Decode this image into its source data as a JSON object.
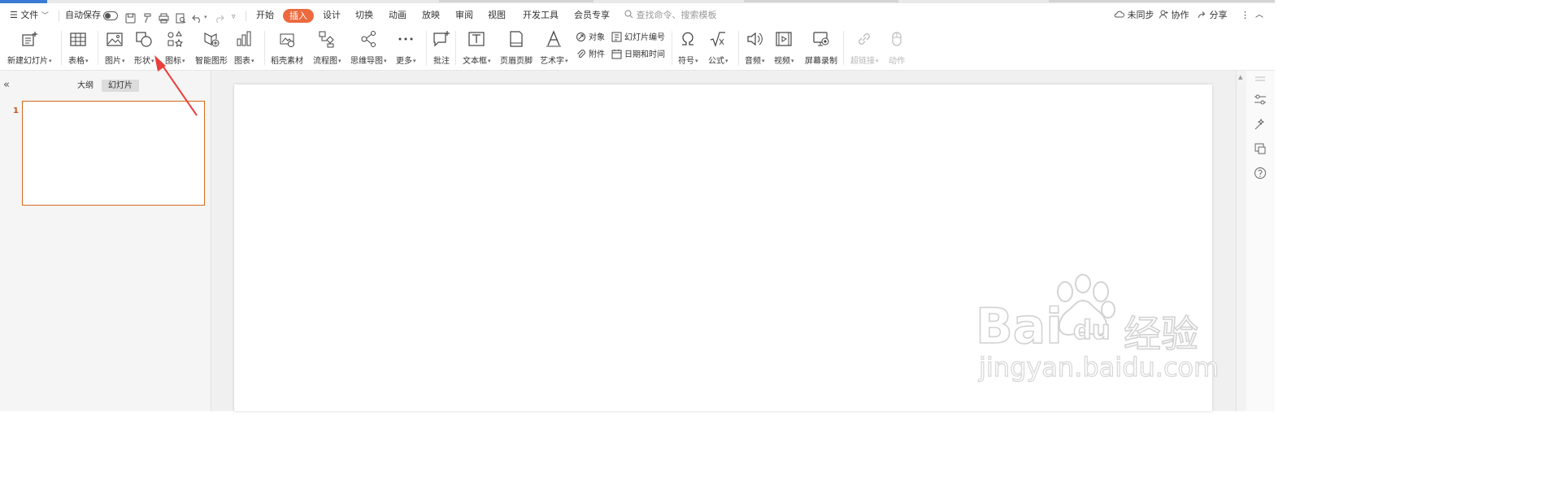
{
  "menubar": {
    "file_label": "文件",
    "autosave_label": "自动保存",
    "tabs": [
      "开始",
      "插入",
      "设计",
      "切换",
      "动画",
      "放映",
      "审阅",
      "视图",
      "开发工具",
      "会员专享"
    ],
    "search_placeholder": "查找命令、搜索模板",
    "sync_label": "未同步",
    "collab_label": "协作",
    "share_label": "分享"
  },
  "ribbon": {
    "new_slide": "新建幻灯片",
    "table": "表格",
    "picture": "图片",
    "shape": "形状",
    "icon": "图标",
    "smart_graphic": "智能图形",
    "chart": "图表",
    "daoke_material": "稻壳素材",
    "flowchart": "流程图",
    "mindmap": "思维导图",
    "more": "更多",
    "comment": "批注",
    "textbox": "文本框",
    "header_footer": "页眉页脚",
    "wordart": "艺术字",
    "object": "对象",
    "attachment": "附件",
    "slide_number": "幻灯片编号",
    "date_time": "日期和时间",
    "symbol": "符号",
    "formula": "公式",
    "audio": "音频",
    "video": "视频",
    "screen_record": "屏幕录制",
    "hyperlink": "超链接",
    "action": "动作"
  },
  "leftpanel": {
    "tab_outline": "大纲",
    "tab_slides": "幻灯片",
    "slide_number": "1"
  },
  "watermark": {
    "brand": "Bai",
    "brand_du": "du",
    "suffix": "经验",
    "url": "jingyan.baidu.com"
  },
  "colors": {
    "accent_orange": "#ec6a3e",
    "thumb_border": "#d2691e",
    "arrow_red": "#e8403c"
  }
}
